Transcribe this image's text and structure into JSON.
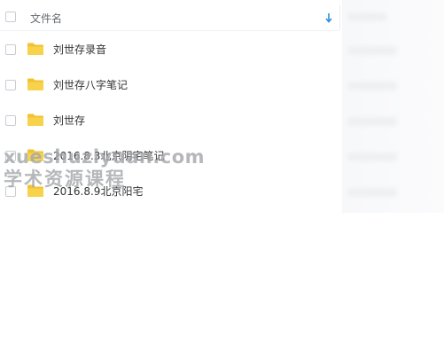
{
  "file_list": {
    "header": {
      "column_name_label": "文件名",
      "sort_icon": "sort-descending-arrow-icon"
    },
    "items": [
      {
        "name": "刘世存录音",
        "icon": "folder-icon"
      },
      {
        "name": "刘世存八字笔记",
        "icon": "folder-icon"
      },
      {
        "name": "刘世存",
        "icon": "folder-icon"
      },
      {
        "name": "2016.8.3北京阴宅笔记",
        "icon": "folder-icon"
      },
      {
        "name": "2016.8.9北京阳宅",
        "icon": "folder-icon"
      }
    ]
  },
  "watermark": {
    "line1": "xueshuziyuan.com",
    "line2": "学术资源课程"
  },
  "colors": {
    "folder": "#f7d24a",
    "folder_tab": "#f1c232",
    "sort_accent": "#2a8fe0",
    "text": "#333333",
    "header_text": "#666a70"
  }
}
